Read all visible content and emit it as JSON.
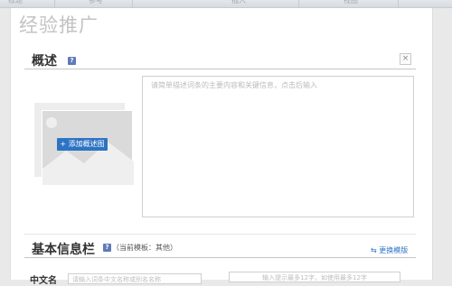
{
  "header": {
    "tabs": [
      "标题",
      "参考",
      "插入",
      "视图"
    ]
  },
  "page_title": "经验推广",
  "overview": {
    "title": "概述",
    "help_glyph": "?",
    "close_glyph": "×",
    "add_image_label": "+ 添加概述图",
    "summary_placeholder": "请简单描述词条的主要内容和关键信息，点击后输入"
  },
  "basic_info": {
    "title": "基本信息栏",
    "help_glyph": "?",
    "template_note": "（当前模板：其他）",
    "switch_icon_glyph": "⇆",
    "switch_template_label": "更换模版",
    "field_label": "中文名",
    "field_placeholder": "请输入词条中文名称或别名名称",
    "right_field_hint": "输入提示最多12字，如使用最多12字"
  },
  "colors": {
    "accent": "#2d73c4",
    "help_icon": "#5f7ab8"
  }
}
